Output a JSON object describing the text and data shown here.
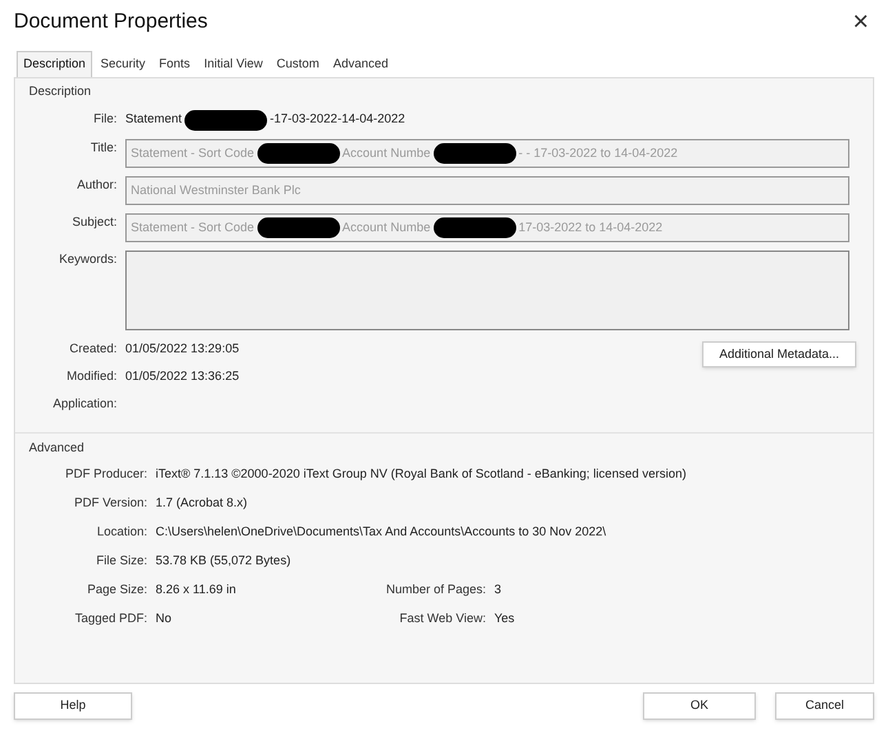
{
  "window": {
    "title": "Document Properties",
    "close": "×"
  },
  "tabs": [
    {
      "label": "Description",
      "selected": true
    },
    {
      "label": "Security",
      "selected": false
    },
    {
      "label": "Fonts",
      "selected": false
    },
    {
      "label": "Initial View",
      "selected": false
    },
    {
      "label": "Custom",
      "selected": false
    },
    {
      "label": "Advanced",
      "selected": false
    }
  ],
  "description": {
    "heading": "Description",
    "file": {
      "label": "File:",
      "parts": [
        {
          "kind": "text",
          "text": "Statement"
        },
        {
          "kind": "redaction"
        },
        {
          "kind": "text",
          "text": "-17-03-2022-14-04-2022"
        }
      ]
    },
    "fields": [
      {
        "label": "Title:",
        "kind": "line",
        "parts": [
          {
            "kind": "text",
            "text": "Statement - Sort Code"
          },
          {
            "kind": "redaction"
          },
          {
            "kind": "text",
            "text": "Account Numbe"
          },
          {
            "kind": "redaction"
          },
          {
            "kind": "text",
            "text": "- - 17-03-2022 to 14-04-2022"
          }
        ]
      },
      {
        "label": "Author:",
        "kind": "line",
        "parts": [
          {
            "kind": "text",
            "text": "National Westminster Bank Plc"
          }
        ]
      },
      {
        "label": "Subject:",
        "kind": "line",
        "parts": [
          {
            "kind": "text",
            "text": "Statement - Sort Code"
          },
          {
            "kind": "redaction"
          },
          {
            "kind": "text",
            "text": "Account Numbe"
          },
          {
            "kind": "redaction"
          },
          {
            "kind": "text",
            "text": "17-03-2022 to 14-04-2022"
          }
        ]
      },
      {
        "label": "Keywords:",
        "kind": "area"
      }
    ],
    "dates": [
      {
        "label": "Created:",
        "value": "01/05/2022 13:29:05"
      },
      {
        "label": "Modified:",
        "value": "01/05/2022 13:36:25"
      },
      {
        "label": "Application:"
      }
    ],
    "metadata_button": "Additional Metadata..."
  },
  "advanced": {
    "heading": "Advanced",
    "rows": [
      [
        {
          "label": "PDF Producer:",
          "value": "iText® 7.1.13 ©2000-2020 iText Group NV (Royal Bank of Scotland - eBanking; licensed version)"
        }
      ],
      [
        {
          "label": "PDF Version:",
          "value": "1.7 (Acrobat 8.x)"
        }
      ],
      [
        {
          "label": "Location:",
          "value": "C:\\Users\\helen\\OneDrive\\Documents\\Tax And Accounts\\Accounts to 30 Nov 2022\\"
        }
      ],
      [
        {
          "label": "File Size:",
          "value": "53.78 KB (55,072 Bytes)"
        }
      ],
      [
        {
          "label": "Page Size:",
          "value": "8.26 x 11.69 in"
        },
        {
          "label": "Number of Pages:",
          "value": "3"
        }
      ],
      [
        {
          "label": "Tagged PDF:",
          "value": "No"
        },
        {
          "label": "Fast Web View:",
          "value": "Yes"
        }
      ]
    ]
  },
  "buttons": {
    "help": "Help",
    "ok": "OK",
    "cancel": "Cancel"
  }
}
